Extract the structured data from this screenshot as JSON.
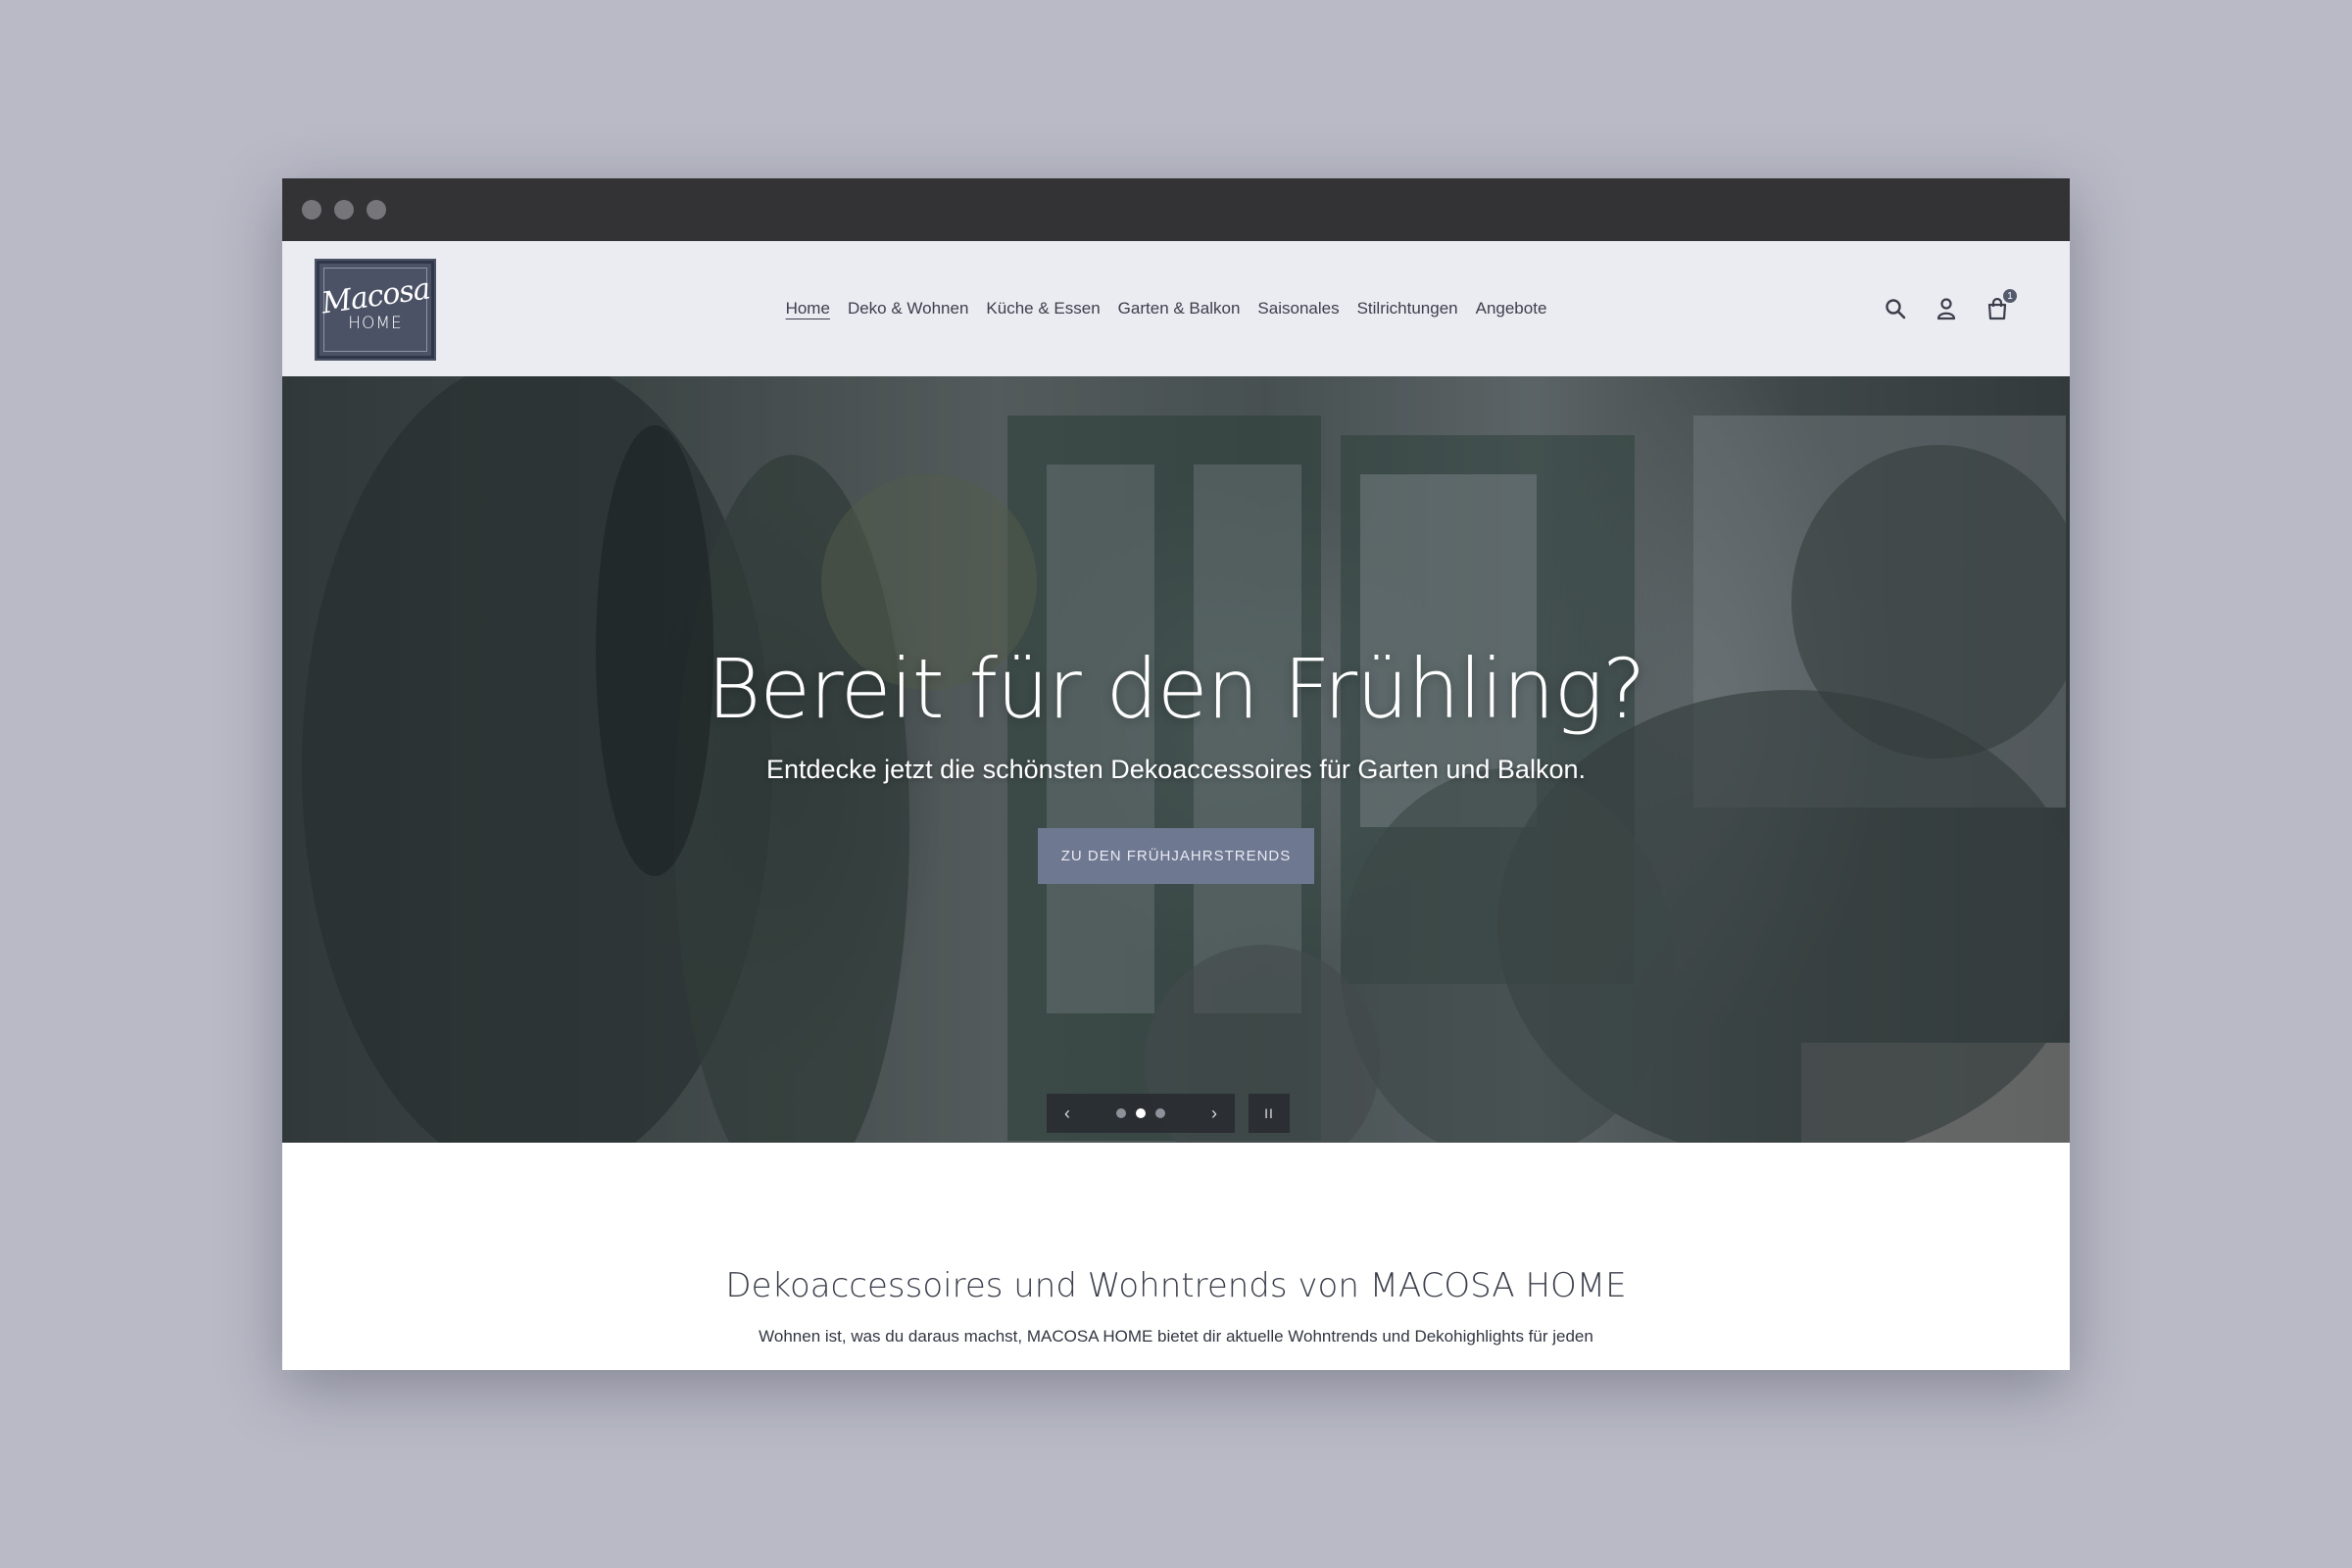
{
  "window": {
    "controls": [
      "close",
      "minimize",
      "maximize"
    ]
  },
  "header": {
    "logo": {
      "script": "Macosa",
      "word": "HOME"
    },
    "nav": [
      {
        "label": "Home",
        "active": true
      },
      {
        "label": "Deko & Wohnen"
      },
      {
        "label": "Küche & Essen"
      },
      {
        "label": "Garten & Balkon"
      },
      {
        "label": "Saisonales"
      },
      {
        "label": "Stilrichtungen"
      },
      {
        "label": "Angebote"
      }
    ],
    "icons": {
      "search": "search-icon",
      "account": "user-icon",
      "cart": "cart-icon"
    },
    "cart_count": "1"
  },
  "hero": {
    "title": "Bereit für den Frühling?",
    "subtitle": "Entdecke jetzt die schönsten Dekoaccessoires für Garten und Balkon.",
    "cta_label": "ZU DEN FRÜHJAHRSTRENDS",
    "slider": {
      "prev": "‹",
      "next": "›",
      "slides": 3,
      "active_slide": 2,
      "pause": "II"
    }
  },
  "intro": {
    "title": "Dekoaccessoires und Wohntrends von MACOSA HOME",
    "text": "Wohnen ist, was du daraus machst, MACOSA HOME bietet dir aktuelle Wohntrends und Dekohighlights für jeden"
  },
  "colors": {
    "background": "#b9bac6",
    "header_bg": "#ebecf1",
    "cta": "#6f7891",
    "logo": "#4b5266"
  }
}
